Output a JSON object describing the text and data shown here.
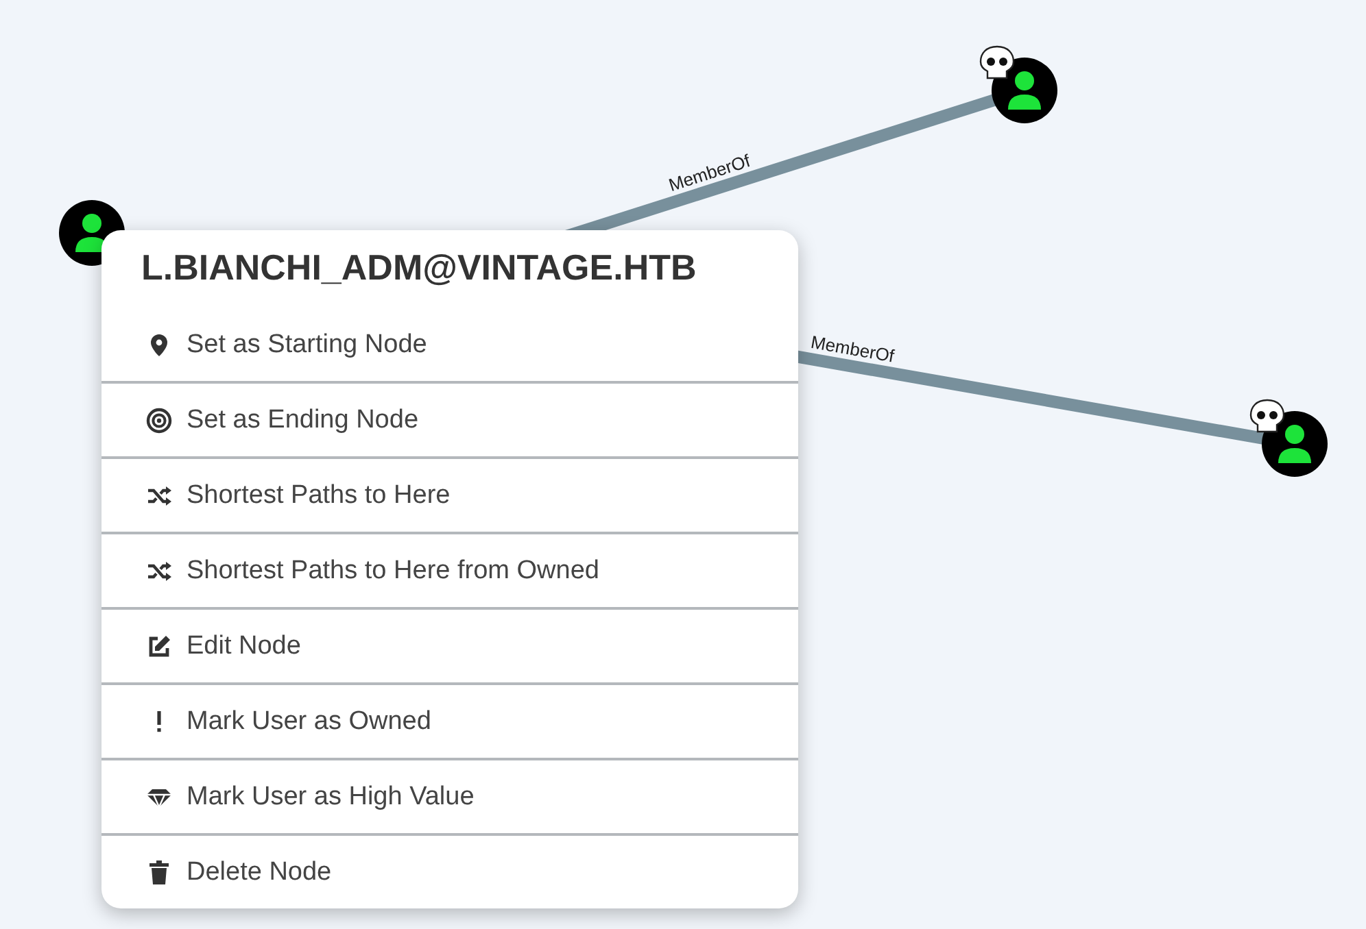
{
  "graph": {
    "nodes": [
      {
        "kind": "user",
        "owned": false
      },
      {
        "kind": "user",
        "owned": true
      },
      {
        "kind": "user",
        "owned": true
      }
    ],
    "edges": [
      {
        "label": "MemberOf"
      },
      {
        "label": "MemberOf"
      }
    ]
  },
  "context_menu": {
    "title": "L.BIANCHI_ADM@VINTAGE.HTB",
    "items": [
      {
        "kind": "pin",
        "label": "Set as Starting Node"
      },
      {
        "kind": "target",
        "label": "Set as Ending Node"
      },
      {
        "kind": "shuffle",
        "label": "Shortest Paths to Here"
      },
      {
        "kind": "shuffle",
        "label": "Shortest Paths to Here from Owned"
      },
      {
        "kind": "edit",
        "label": "Edit Node"
      },
      {
        "kind": "exclamation",
        "label": "Mark User as Owned"
      },
      {
        "kind": "gem",
        "label": "Mark User as High Value"
      },
      {
        "kind": "trash",
        "label": "Delete Node"
      }
    ]
  }
}
